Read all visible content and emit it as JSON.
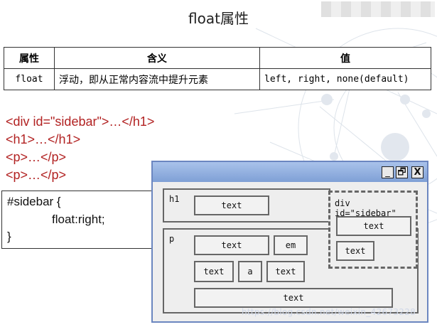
{
  "slide": {
    "title": "float属性",
    "watermark": "https://blog.csdn.net/weixin_42673228"
  },
  "table": {
    "headers": [
      "属性",
      "含义",
      "值"
    ],
    "row": [
      "float",
      "浮动，即从正常内容流中提升元素",
      "left, right, none(default)"
    ]
  },
  "code_lines": [
    "<div id=\"sidebar\">…</h1>",
    "<h1>…</h1>",
    "<p>…</p>",
    "<p>…</p>"
  ],
  "css_code": [
    "#sidebar {",
    "float:right;",
    "}"
  ],
  "window": {
    "buttons": {
      "minimize": "_",
      "restore": "🗗",
      "close": "X"
    },
    "h1_label": "h1",
    "p_label": "p",
    "sidebar_label": "div id=\"sidebar\"",
    "text_box": "text",
    "em_box": "em",
    "a_box": "a"
  },
  "colors": {
    "code_red": "#b22222",
    "titlebar": "#8eabdc",
    "panel_border": "#666666"
  }
}
